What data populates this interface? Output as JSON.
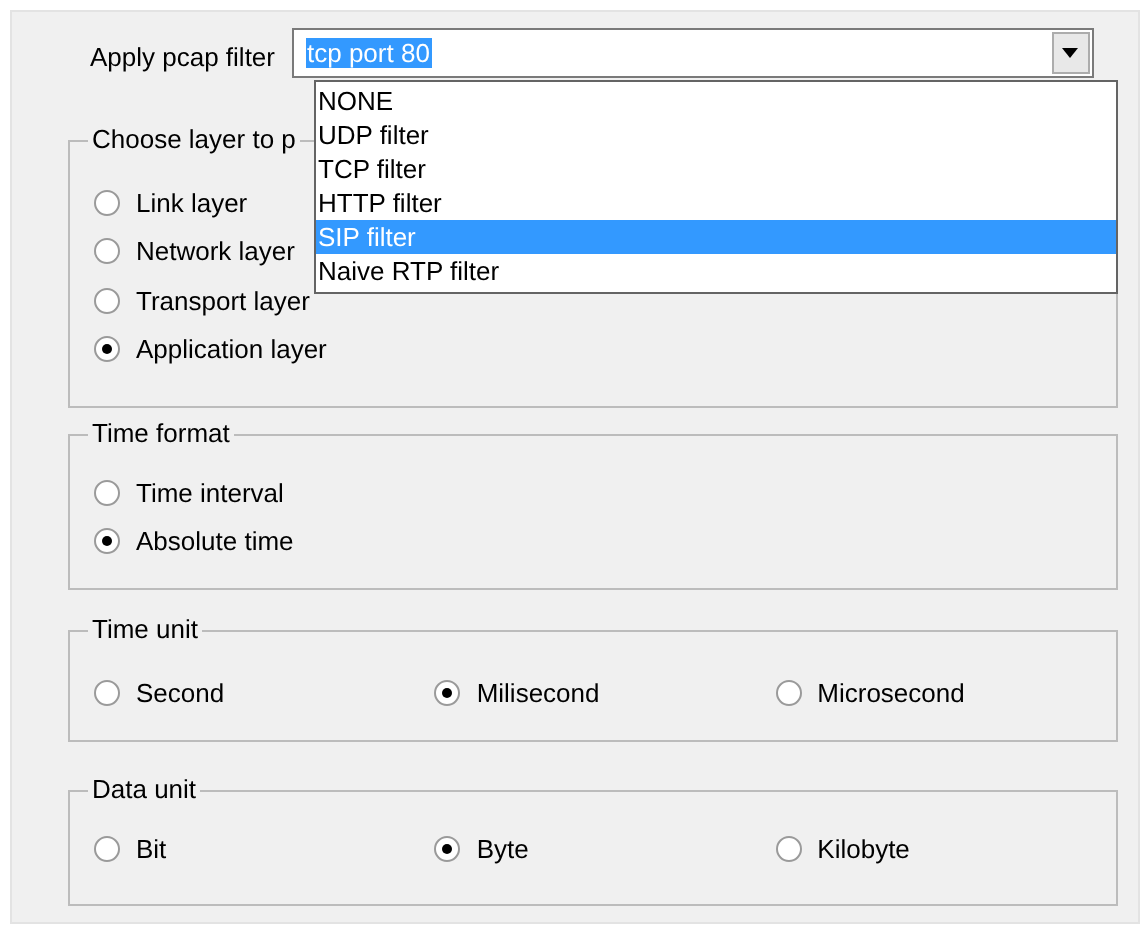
{
  "filter": {
    "label": "Apply pcap filter",
    "value": "tcp port 80",
    "options": [
      {
        "label": "NONE",
        "selected": false
      },
      {
        "label": "UDP filter",
        "selected": false
      },
      {
        "label": "TCP filter",
        "selected": false
      },
      {
        "label": "HTTP filter",
        "selected": false
      },
      {
        "label": "SIP filter",
        "selected": true
      },
      {
        "label": "Naive RTP filter",
        "selected": false
      }
    ]
  },
  "groups": [
    {
      "title": "Choose layer to p",
      "kind": "stacked",
      "options": [
        {
          "label": "Link layer",
          "selected": false
        },
        {
          "label": "Network layer",
          "selected": false
        },
        {
          "label": "Transport layer",
          "selected": false
        },
        {
          "label": "Application layer",
          "selected": true
        }
      ]
    },
    {
      "title": "Time format",
      "kind": "stacked",
      "options": [
        {
          "label": "Time interval",
          "selected": false
        },
        {
          "label": "Absolute time",
          "selected": true
        }
      ]
    },
    {
      "title": "Time unit",
      "kind": "inline",
      "options": [
        {
          "label": "Second",
          "selected": false
        },
        {
          "label": "Milisecond",
          "selected": true
        },
        {
          "label": "Microsecond",
          "selected": false
        }
      ]
    },
    {
      "title": "Data unit",
      "kind": "inline",
      "options": [
        {
          "label": "Bit",
          "selected": false
        },
        {
          "label": "Byte",
          "selected": true
        },
        {
          "label": "Kilobyte",
          "selected": false
        }
      ]
    }
  ]
}
